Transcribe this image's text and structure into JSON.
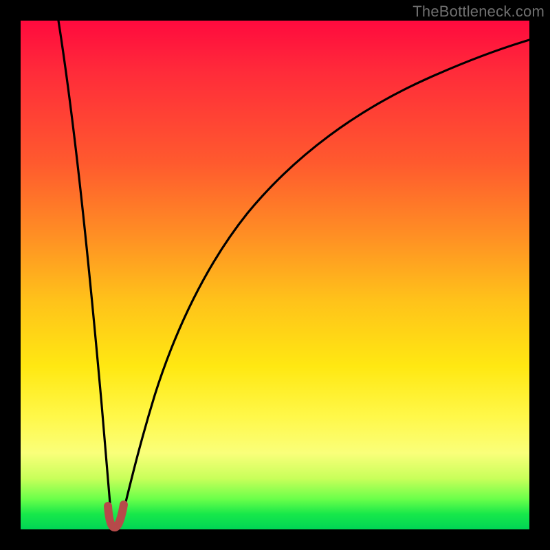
{
  "watermark": "TheBottleneck.com",
  "colors": {
    "frame": "#000000",
    "curve_main": "#000000",
    "curve_marker": "#b64a4a",
    "gradient_top": "#ff0a3e",
    "gradient_bottom": "#00d455"
  },
  "chart_data": {
    "type": "line",
    "title": "",
    "xlabel": "",
    "ylabel": "",
    "xlim": [
      0,
      100
    ],
    "ylim": [
      0,
      100
    ],
    "x": [
      0,
      1,
      2,
      3,
      4,
      5,
      6,
      7,
      8,
      9,
      10,
      11,
      12,
      13,
      14,
      15,
      16,
      17,
      18,
      19,
      20,
      22,
      24,
      26,
      28,
      30,
      33,
      36,
      40,
      45,
      50,
      55,
      60,
      65,
      70,
      75,
      80,
      85,
      90,
      95,
      100
    ],
    "values": [
      100,
      94,
      88,
      82,
      76,
      70,
      64,
      58,
      52,
      46,
      40,
      34,
      28,
      22,
      17,
      11,
      6,
      2,
      0,
      0,
      2,
      8,
      15,
      22,
      28,
      34,
      41,
      48,
      55,
      62,
      68,
      73,
      77,
      81,
      84,
      87,
      89,
      91,
      93,
      94,
      95
    ],
    "marker_segment": {
      "x": [
        17.3,
        17.6,
        18.0,
        18.5,
        19.0,
        19.4,
        19.7
      ],
      "y": [
        3.0,
        1.2,
        0.3,
        0.0,
        0.3,
        1.2,
        3.0
      ]
    },
    "notes": "Values are read from pixel positions; axes have no printed ticks or labels so x and y are normalized 0–100 (x left→right, y bottom→top). Curve is bottleneck-style: steep fall from top-left to a minimum near x≈18, then asymptotic rise toward top-right. The small marker_segment is drawn thicker in a muted red at the trough."
  }
}
